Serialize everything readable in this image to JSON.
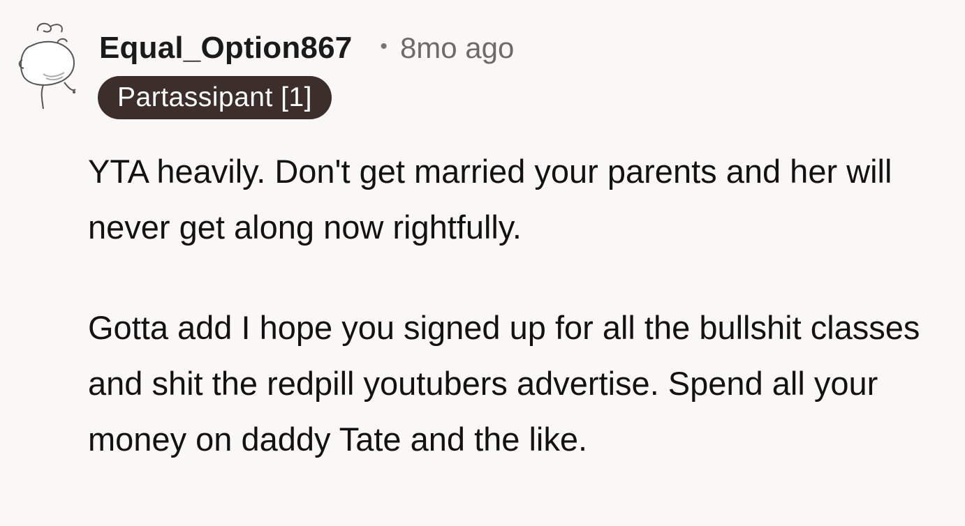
{
  "comment": {
    "username": "Equal_Option867",
    "separator": "•",
    "timestamp": "8mo ago",
    "flair": "Partassipant [1]",
    "avatar_icon": "reddit-snoo-avatar-icon",
    "paragraphs": [
      "YTA heavily. Don't get married your parents and her will never get along now rightfully.",
      "Gotta add I hope you signed up for all the bullshit classes and shit the redpill youtubers advertise. Spend all your money on daddy Tate and the like."
    ]
  },
  "colors": {
    "background": "#f9f8f7",
    "flair_background": "#3c2f2b",
    "flair_text": "#ffffff",
    "timestamp": "#6e6a67"
  }
}
